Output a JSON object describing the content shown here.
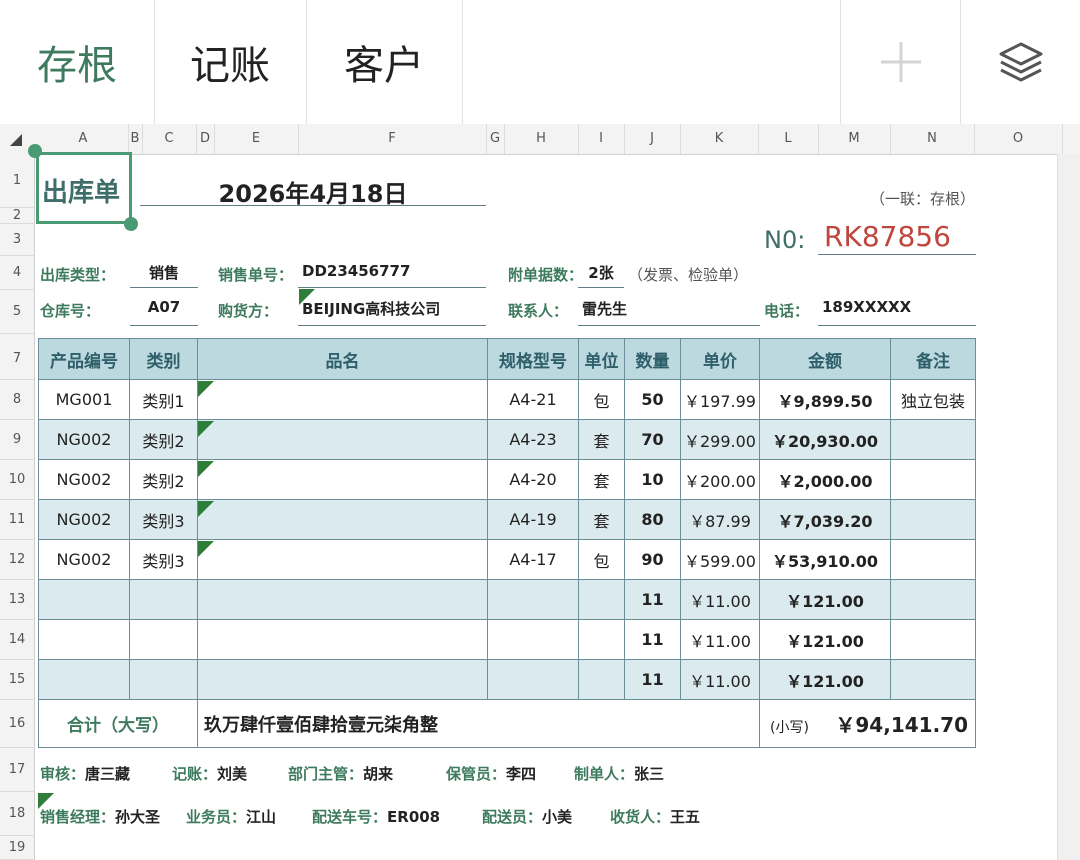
{
  "toolbar": {
    "tabs": [
      {
        "label": "存根"
      },
      {
        "label": "记账"
      },
      {
        "label": "客户"
      }
    ]
  },
  "columns": [
    "A",
    "B",
    "C",
    "D",
    "E",
    "F",
    "G",
    "H",
    "I",
    "J",
    "K",
    "L",
    "M",
    "N",
    "O"
  ],
  "rows": [
    "1",
    "2",
    "3",
    "4",
    "5",
    "7",
    "8",
    "9",
    "10",
    "11",
    "12",
    "13",
    "14",
    "15",
    "16",
    "17",
    "18",
    "19"
  ],
  "doc": {
    "title": "出库单",
    "date": "2026年4月18日",
    "copy_note": "（一联：存根）",
    "no_label": "N0:",
    "no_value": "RK87856",
    "type_label": "出库类型：",
    "type_value": "销售",
    "sales_no_label": "销售单号：",
    "sales_no_value": "DD23456777",
    "attach_label": "附单据数：",
    "attach_value": "2张",
    "attach_note": "（发票、检验单）",
    "warehouse_label": "仓库号：",
    "warehouse_value": "A07",
    "buyer_label": "购货方：",
    "buyer_value": "BEIJING高科技公司",
    "contact_label": "联系人：",
    "contact_value": "雷先生",
    "phone_label": "电话：",
    "phone_value": "189XXXXX"
  },
  "table": {
    "headers": [
      "产品编号",
      "类别",
      "品名",
      "规格型号",
      "单位",
      "数量",
      "单价",
      "金额",
      "备注"
    ],
    "rows": [
      [
        "MG001",
        "类别1",
        "",
        "A4-21",
        "包",
        "50",
        "￥197.99",
        "￥9,899.50",
        "独立包装"
      ],
      [
        "NG002",
        "类别2",
        "",
        "A4-23",
        "套",
        "70",
        "￥299.00",
        "￥20,930.00",
        ""
      ],
      [
        "NG002",
        "类别2",
        "",
        "A4-20",
        "套",
        "10",
        "￥200.00",
        "￥2,000.00",
        ""
      ],
      [
        "NG002",
        "类别3",
        "",
        "A4-19",
        "套",
        "80",
        "￥87.99",
        "￥7,039.20",
        ""
      ],
      [
        "NG002",
        "类别3",
        "",
        "A4-17",
        "包",
        "90",
        "￥599.00",
        "￥53,910.00",
        ""
      ],
      [
        "",
        "",
        "",
        "",
        "",
        "11",
        "￥11.00",
        "￥121.00",
        ""
      ],
      [
        "",
        "",
        "",
        "",
        "",
        "11",
        "￥11.00",
        "￥121.00",
        ""
      ],
      [
        "",
        "",
        "",
        "",
        "",
        "11",
        "￥11.00",
        "￥121.00",
        ""
      ]
    ],
    "total_label": "合计（大写）",
    "total_words": "玖万肆仟壹佰肆拾壹元柒角整",
    "small_label": "(小写)",
    "small_value": "￥94,141.70"
  },
  "signatures": {
    "row1": [
      {
        "k": "审核：",
        "v": "唐三藏"
      },
      {
        "k": "记账：",
        "v": "刘美"
      },
      {
        "k": "部门主管：",
        "v": "胡来"
      },
      {
        "k": "保管员：",
        "v": "李四"
      },
      {
        "k": "制单人：",
        "v": "张三"
      }
    ],
    "row2": [
      {
        "k": "销售经理：",
        "v": "孙大圣"
      },
      {
        "k": "业务员：",
        "v": "江山"
      },
      {
        "k": "配送车号：",
        "v": "ER008"
      },
      {
        "k": "配送员：",
        "v": "小美"
      },
      {
        "k": "收货人：",
        "v": "王五"
      }
    ]
  },
  "colors": {
    "accent": "#3e7b5e",
    "number_red": "#c0453d",
    "header_fill": "#bcd9df",
    "alt_fill": "#dbeaee"
  },
  "icons": [
    "plus-icon",
    "layers-icon"
  ]
}
